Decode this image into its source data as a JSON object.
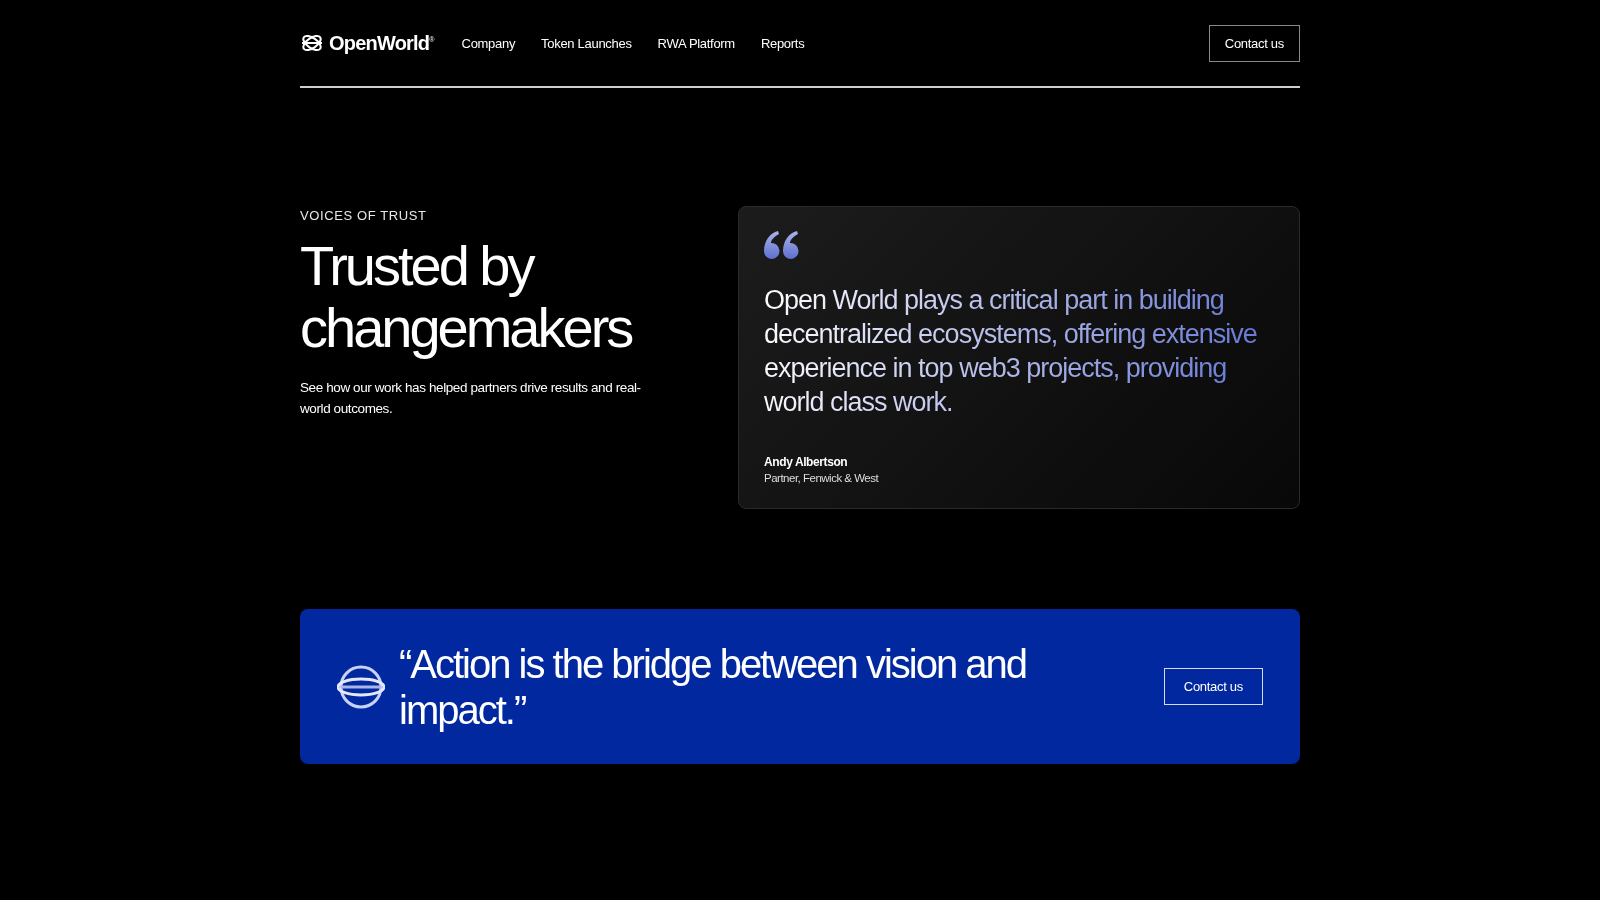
{
  "header": {
    "logo": "OpenWorld$^{®}$",
    "nav": [
      {
        "label": "Company"
      },
      {
        "label": "Token Launches"
      },
      {
        "label": "RWA Platform"
      },
      {
        "label": "Reports"
      }
    ],
    "cta": "Contact us"
  },
  "intro": {
    "eyebrow": "VOICES OF TRUST",
    "title": "Trusted by changemakers",
    "description": "See how our work has helped partners drive results and real-world outcomes."
  },
  "testimonial": {
    "quote": "Open World plays a critical part in building decentralized ecosystems, offering extensive experience in top web3 projects, providing world class work.",
    "author": "Andy Albertson",
    "role": "Partner, Fenwick & West"
  },
  "banner": {
    "quote": "“Action is the bridge between vision and impact.”",
    "cta": "Contact us"
  }
}
